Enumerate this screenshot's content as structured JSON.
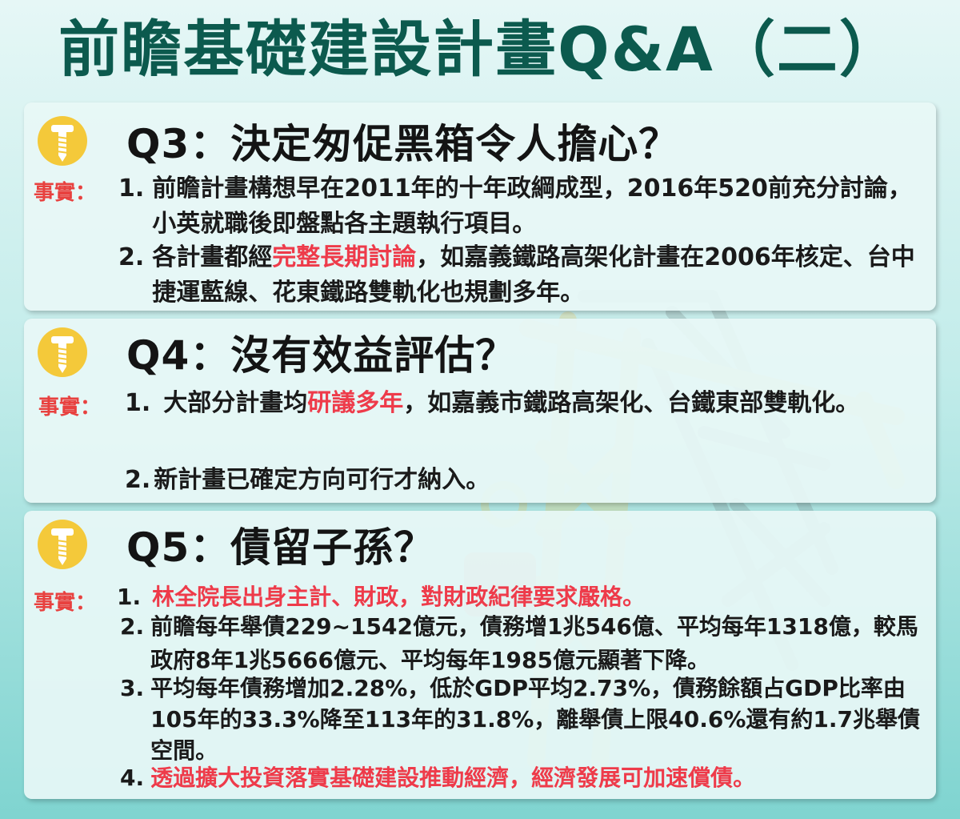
{
  "title": "前瞻基礎建設計畫Q&A（二）",
  "colors": {
    "title": "#0c5a4e",
    "highlight": "#ee3b4a",
    "icon": "#f4c93a"
  },
  "fact_label": "事實：",
  "q3": {
    "question": "Q3：決定匆促黑箱令人擔心？",
    "items": [
      {
        "num": "1.",
        "text": "前瞻計畫構想早在2011年的十年政綱成型，2016年520前充分討論，小英就職後即盤點各主題執行項目。"
      },
      {
        "num": "2.",
        "pre": "各計畫都經",
        "hl": "完整長期討論",
        "post": "，如嘉義鐵路高架化計畫在2006年核定、台中捷運藍線、花東鐵路雙軌化也規劃多年。"
      }
    ]
  },
  "q4": {
    "question": "Q4：沒有效益評估？",
    "items": [
      {
        "num": "1.",
        "pre": "大部分計畫均",
        "hl": "研議多年",
        "post": "，如嘉義市鐵路高架化、台鐵東部雙軌化。"
      },
      {
        "num": "2.",
        "text": "新計畫已確定方向可行才納入。"
      }
    ]
  },
  "q5": {
    "question": "Q5：債留子孫？",
    "items": [
      {
        "num": "1.",
        "text": "林全院長出身主計、財政，對財政紀律要求嚴格。"
      },
      {
        "num": "2.",
        "text": "前瞻每年舉債229~1542億元，債務增1兆546億、平均每年1318億，較馬政府8年1兆5666億元、平均每年1985億元顯著下降。"
      },
      {
        "num": "3.",
        "text": "平均每年債務增加2.28%，低於GDP平均2.73%，債務餘額占GDP比率由105年的33.3%降至113年的31.8%，離舉債上限40.6%還有約1.7兆舉債空間。"
      },
      {
        "num": "4.",
        "text": "透過擴大投資落實基礎建設推動經濟，經濟發展可加速償債。"
      }
    ]
  }
}
